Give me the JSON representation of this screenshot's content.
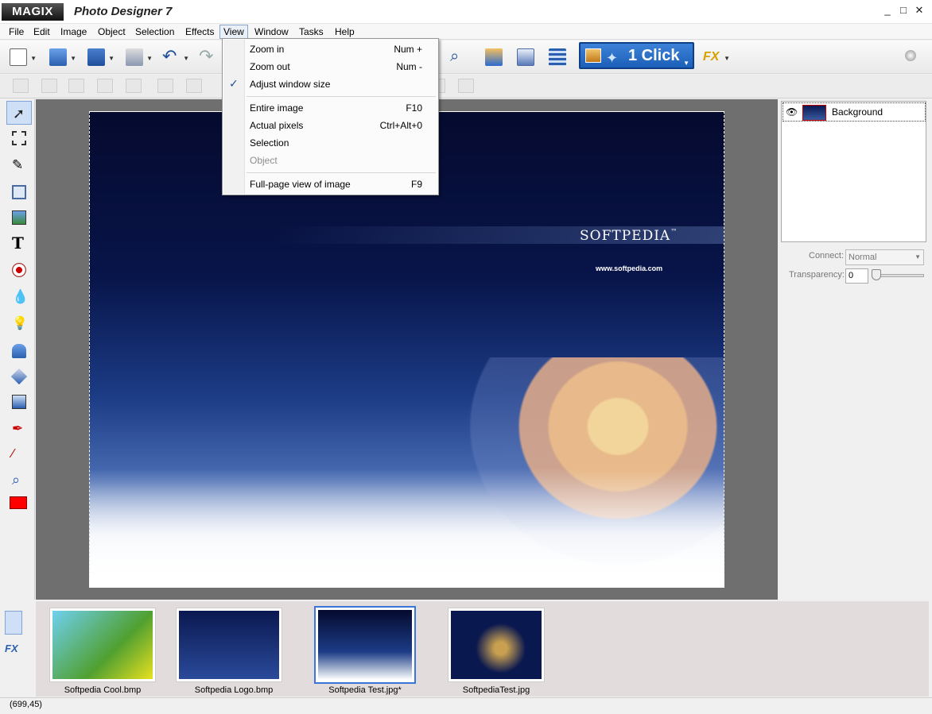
{
  "window": {
    "brand": "MAGIX",
    "title": "Photo Designer 7",
    "controls": [
      "_",
      "□",
      "✕"
    ]
  },
  "menubar": [
    "File",
    "Edit",
    "Image",
    "Object",
    "Selection",
    "Effects",
    "View",
    "Window",
    "Tasks",
    "Help"
  ],
  "open_menu": "View",
  "view_menu": {
    "items": [
      {
        "label": "Zoom in",
        "shortcut": "Num +"
      },
      {
        "label": "Zoom out",
        "shortcut": "Num -"
      },
      {
        "label": "Adjust window size",
        "shortcut": "",
        "checked": true
      },
      {
        "label": "Entire image",
        "shortcut": "F10"
      },
      {
        "label": "Actual pixels",
        "shortcut": "Ctrl+Alt+0"
      },
      {
        "label": "Selection",
        "shortcut": ""
      },
      {
        "label": "Object",
        "shortcut": "",
        "disabled": true
      },
      {
        "label": "Full-page view of image",
        "shortcut": "F9"
      }
    ],
    "check_glyph": "✓"
  },
  "toolbar": {
    "one_click_label": "1 Click",
    "fx_label": "FX"
  },
  "canvas": {
    "brand_text": "SOFTPEDIA",
    "brand_tm": "™",
    "url_text": "www.softpedia.com"
  },
  "layers": {
    "items": [
      {
        "name": "Background",
        "visible": true
      }
    ],
    "eye_glyph": "👁"
  },
  "properties": {
    "connect_label": "Connect:",
    "connect_value": "Normal",
    "transparency_label": "Transparency:",
    "transparency_value": "0"
  },
  "filmstrip": [
    {
      "caption": "Softpedia Cool.bmp",
      "selected": false
    },
    {
      "caption": "Softpedia Logo.bmp",
      "selected": false
    },
    {
      "caption": "Softpedia Test.jpg*",
      "selected": true
    },
    {
      "caption": "SoftpediaTest.jpg",
      "selected": false
    }
  ],
  "status": {
    "coords": "(699,45)"
  },
  "colors": {
    "accent": "#1c5fb8",
    "foreground_swatch": "#ff0000",
    "workspace": "#6f6f6f"
  }
}
